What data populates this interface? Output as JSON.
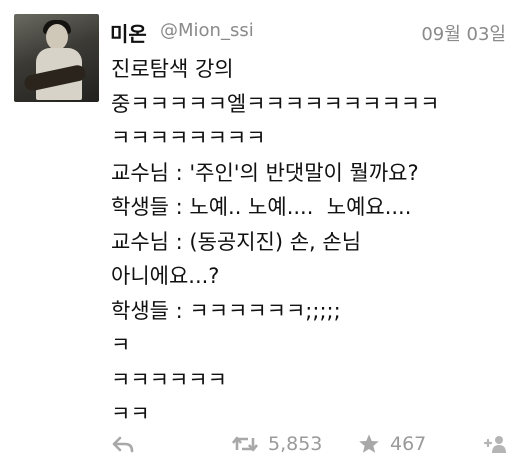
{
  "tweet": {
    "name": "미온",
    "handle": "@Mion_ssi",
    "date": "09월 03일",
    "lines": [
      "진로탐색 강의",
      "중ㅋㅋㅋㅋㅋ엘ㅋㅋㅋㅋㅋㅋㅋㅋㅋㅋ",
      "ㅋㅋㅋㅋㅋㅋㅋㅋ",
      "교수님 : '주인'의 반댓말이 뭘까요?",
      "학생들 : 노예.. 노예....  노예요....",
      "교수님 : (동공지진) 손, 손님",
      "아니에요...?",
      "학생들 : ㅋㅋㅋㅋㅋㅋ;;;;;",
      "ㅋ",
      "ㅋㅋㅋㅋㅋㅋ",
      "ㅋㅋ"
    ],
    "actions": {
      "retweet_count": "5,853",
      "favorite_count": "467",
      "reply_icon": "reply-icon",
      "retweet_icon": "retweet-icon",
      "favorite_icon": "star-icon",
      "follow_icon": "add-user-icon"
    }
  }
}
